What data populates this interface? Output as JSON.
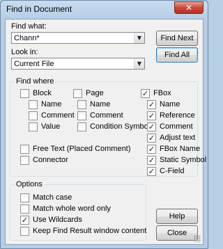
{
  "window": {
    "title": "Find in Document",
    "close_glyph": "✕"
  },
  "find_what": {
    "label": "Find what:",
    "value": "Chann*"
  },
  "look_in": {
    "label": "Look in:",
    "value": "Current File"
  },
  "buttons": {
    "find_next": "Find Next",
    "find_all": "Find All",
    "help": "Help",
    "close": "Close"
  },
  "find_where": {
    "title": "Find where",
    "block": {
      "label": "Block",
      "checked": false,
      "items": [
        {
          "label": "Name",
          "checked": false
        },
        {
          "label": "Comment",
          "checked": false
        },
        {
          "label": "Value",
          "checked": false
        }
      ]
    },
    "page": {
      "label": "Page",
      "checked": false,
      "items": [
        {
          "label": "Name",
          "checked": false
        },
        {
          "label": "Comment",
          "checked": false
        },
        {
          "label": "Condition Symbol",
          "checked": false
        }
      ]
    },
    "fbox": {
      "label": "FBox",
      "checked": true,
      "items": [
        {
          "label": "Name",
          "checked": true
        },
        {
          "label": "Reference",
          "checked": true
        },
        {
          "label": "Comment",
          "checked": true
        },
        {
          "label": "Adjust text",
          "checked": true
        },
        {
          "label": "FBox Name",
          "checked": true
        },
        {
          "label": "Static Symbol",
          "checked": true
        },
        {
          "label": "C-Field",
          "checked": true
        }
      ]
    },
    "free_text": {
      "label": "Free Text (Placed Comment)",
      "checked": false
    },
    "connector": {
      "label": "Connector",
      "checked": false
    }
  },
  "options": {
    "title": "Options",
    "items": [
      {
        "label": "Match case",
        "checked": false
      },
      {
        "label": "Match whole word only",
        "checked": false
      },
      {
        "label": "Use Wildcards",
        "checked": true
      },
      {
        "label": "Keep Find Result window content",
        "checked": false
      }
    ]
  },
  "icons": {
    "dropdown": "chevron-down-icon",
    "check": "checkmark-icon",
    "close": "close-icon"
  }
}
